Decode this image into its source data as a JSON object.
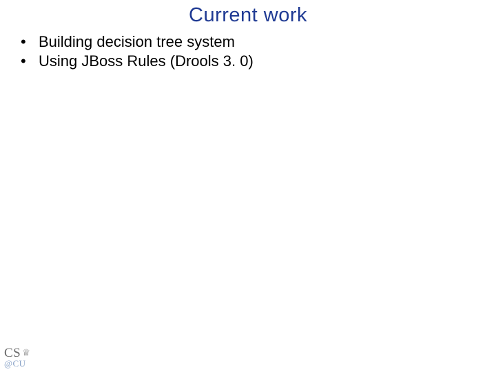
{
  "slide": {
    "title": "Current work",
    "bullets": [
      "Building decision tree system",
      "Using JBoss Rules (Drools 3. 0)"
    ]
  },
  "logo": {
    "top": "CS",
    "crown": "♕",
    "bottom": "@CU"
  }
}
